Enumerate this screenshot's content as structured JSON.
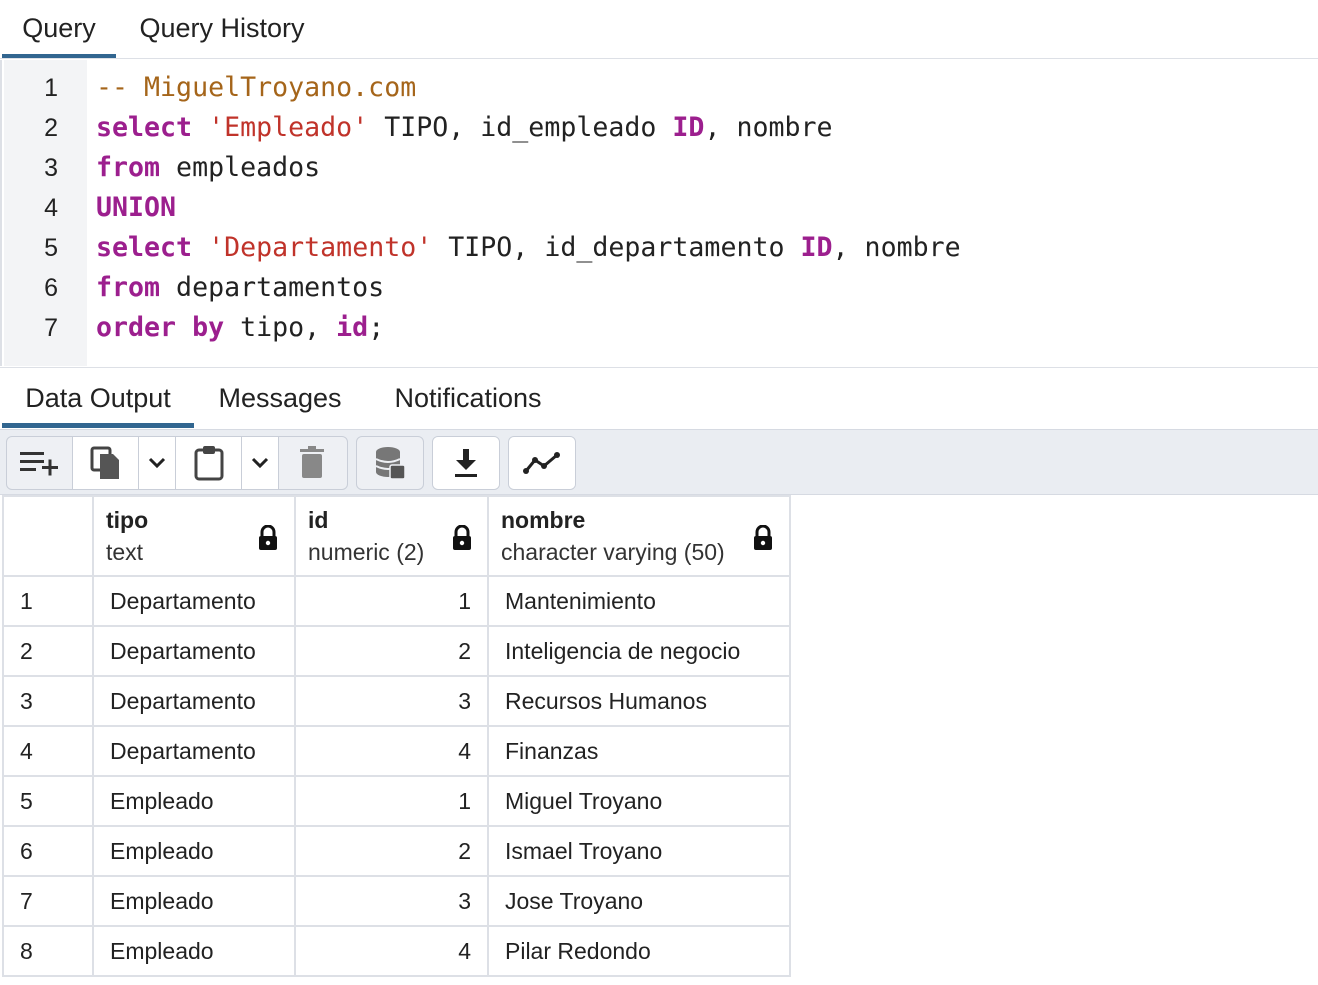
{
  "top_tabs": [
    "Query",
    "Query History"
  ],
  "editor": {
    "line_numbers": [
      "1",
      "2",
      "3",
      "4",
      "5",
      "6",
      "7"
    ],
    "lines": [
      [
        {
          "t": "-- MiguelTroyano.com",
          "c": "cmt"
        }
      ],
      [
        {
          "t": "select",
          "c": "kw"
        },
        {
          "t": " ",
          "c": "plain"
        },
        {
          "t": "'Empleado'",
          "c": "str"
        },
        {
          "t": " TIPO, id_empleado ",
          "c": "plain"
        },
        {
          "t": "ID",
          "c": "kw"
        },
        {
          "t": ", nombre",
          "c": "plain"
        }
      ],
      [
        {
          "t": "from",
          "c": "kw"
        },
        {
          "t": " empleados",
          "c": "plain"
        }
      ],
      [
        {
          "t": "UNION",
          "c": "kw"
        }
      ],
      [
        {
          "t": "select",
          "c": "kw"
        },
        {
          "t": " ",
          "c": "plain"
        },
        {
          "t": "'Departamento'",
          "c": "str"
        },
        {
          "t": " TIPO, id_departamento ",
          "c": "plain"
        },
        {
          "t": "ID",
          "c": "kw"
        },
        {
          "t": ", nombre",
          "c": "plain"
        }
      ],
      [
        {
          "t": "from",
          "c": "kw"
        },
        {
          "t": " departamentos",
          "c": "plain"
        }
      ],
      [
        {
          "t": "order by",
          "c": "kw"
        },
        {
          "t": " tipo, ",
          "c": "plain"
        },
        {
          "t": "id",
          "c": "kw"
        },
        {
          "t": ";",
          "c": "plain"
        }
      ]
    ]
  },
  "output_tabs": [
    "Data Output",
    "Messages",
    "Notifications"
  ],
  "toolbar": {
    "icons": [
      "add-row-icon",
      "copy-icon",
      "chevron-down-icon",
      "paste-icon",
      "chevron-down-icon",
      "delete-icon",
      "save-data-icon",
      "download-icon",
      "graph-icon"
    ]
  },
  "grid": {
    "columns": [
      {
        "name": "tipo",
        "type": "text"
      },
      {
        "name": "id",
        "type": "numeric (2)"
      },
      {
        "name": "nombre",
        "type": "character varying (50)"
      }
    ],
    "rows": [
      {
        "n": "1",
        "tipo": "Departamento",
        "id": "1",
        "nombre": "Mantenimiento"
      },
      {
        "n": "2",
        "tipo": "Departamento",
        "id": "2",
        "nombre": "Inteligencia de negocio"
      },
      {
        "n": "3",
        "tipo": "Departamento",
        "id": "3",
        "nombre": "Recursos Humanos"
      },
      {
        "n": "4",
        "tipo": "Departamento",
        "id": "4",
        "nombre": "Finanzas"
      },
      {
        "n": "5",
        "tipo": "Empleado",
        "id": "1",
        "nombre": "Miguel Troyano"
      },
      {
        "n": "6",
        "tipo": "Empleado",
        "id": "2",
        "nombre": "Ismael Troyano"
      },
      {
        "n": "7",
        "tipo": "Empleado",
        "id": "3",
        "nombre": "Jose Troyano"
      },
      {
        "n": "8",
        "tipo": "Empleado",
        "id": "4",
        "nombre": "Pilar Redondo"
      }
    ]
  },
  "colors": {
    "accent": "#326690",
    "keyword": "#9c1f8e",
    "string": "#c0332a",
    "comment": "#a5651a"
  }
}
